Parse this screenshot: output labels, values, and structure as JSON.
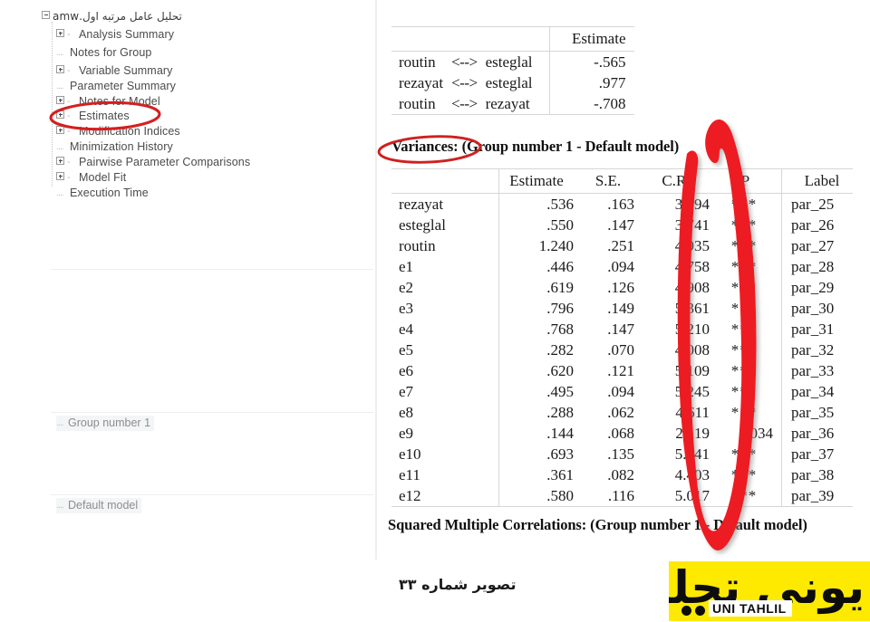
{
  "tree": {
    "root_label": "تحلیل عامل مرتبه اول.amw",
    "items": [
      {
        "label": "Analysis Summary",
        "expandable": true
      },
      {
        "label": "Notes for Group",
        "expandable": false
      },
      {
        "label": "Variable Summary",
        "expandable": true
      },
      {
        "label": "Parameter Summary",
        "expandable": false
      },
      {
        "label": "Notes for Model",
        "expandable": true
      },
      {
        "label": "Estimates",
        "expandable": true
      },
      {
        "label": "Modification Indices",
        "expandable": true
      },
      {
        "label": "Minimization History",
        "expandable": false
      },
      {
        "label": "Pairwise Parameter Comparisons",
        "expandable": true
      },
      {
        "label": "Model Fit",
        "expandable": true
      },
      {
        "label": "Execution Time",
        "expandable": false
      }
    ],
    "group_label": "Group number 1",
    "model_label": "Default model"
  },
  "output": {
    "correlations_table": {
      "header": [
        "",
        "",
        "",
        "Estimate"
      ],
      "rows": [
        {
          "from": "routin",
          "arrow": "<-->",
          "to": "esteglal",
          "estimate": "-.565"
        },
        {
          "from": "rezayat",
          "arrow": "<-->",
          "to": "esteglal",
          "estimate": ".977"
        },
        {
          "from": "routin",
          "arrow": "<-->",
          "to": "rezayat",
          "estimate": "-.708"
        }
      ]
    },
    "variances_heading": "Variances: (Group number 1 - Default model)",
    "variances_table": {
      "columns": [
        "",
        "Estimate",
        "S.E.",
        "C.R.",
        "P",
        "Label"
      ],
      "rows": [
        {
          "name": "rezayat",
          "estimate": ".536",
          "se": ".163",
          "cr": "3.294",
          "p": "***",
          "label": "par_25"
        },
        {
          "name": "esteglal",
          "estimate": ".550",
          "se": ".147",
          "cr": "3.741",
          "p": "***",
          "label": "par_26"
        },
        {
          "name": "routin",
          "estimate": "1.240",
          "se": ".251",
          "cr": "4.935",
          "p": "***",
          "label": "par_27"
        },
        {
          "name": "e1",
          "estimate": ".446",
          "se": ".094",
          "cr": "4.758",
          "p": "***",
          "label": "par_28"
        },
        {
          "name": "e2",
          "estimate": ".619",
          "se": ".126",
          "cr": "4.908",
          "p": "***",
          "label": "par_29"
        },
        {
          "name": "e3",
          "estimate": ".796",
          "se": ".149",
          "cr": "5.361",
          "p": "***",
          "label": "par_30"
        },
        {
          "name": "e4",
          "estimate": ".768",
          "se": ".147",
          "cr": "5.210",
          "p": "***",
          "label": "par_31"
        },
        {
          "name": "e5",
          "estimate": ".282",
          "se": ".070",
          "cr": "4.008",
          "p": "***",
          "label": "par_32"
        },
        {
          "name": "e6",
          "estimate": ".620",
          "se": ".121",
          "cr": "5.109",
          "p": "***",
          "label": "par_33"
        },
        {
          "name": "e7",
          "estimate": ".495",
          "se": ".094",
          "cr": "5.245",
          "p": "***",
          "label": "par_34"
        },
        {
          "name": "e8",
          "estimate": ".288",
          "se": ".062",
          "cr": "4.611",
          "p": "***",
          "label": "par_35"
        },
        {
          "name": "e9",
          "estimate": ".144",
          "se": ".068",
          "cr": "2.119",
          "p": ".034",
          "label": "par_36"
        },
        {
          "name": "e10",
          "estimate": ".693",
          "se": ".135",
          "cr": "5.141",
          "p": "***",
          "label": "par_37"
        },
        {
          "name": "e11",
          "estimate": ".361",
          "se": ".082",
          "cr": "4.403",
          "p": "***",
          "label": "par_38"
        },
        {
          "name": "e12",
          "estimate": ".580",
          "se": ".116",
          "cr": "5.017",
          "p": "***",
          "label": "par_39"
        }
      ]
    },
    "smc_heading": "Squared Multiple Correlations: (Group number 1 - Default model)"
  },
  "annotations": {
    "color": "#e01b1b",
    "ellipse_estimates_target": "Estimates",
    "ellipse_variances_target": "Variances:",
    "arrow_target_column": "P"
  },
  "footer": {
    "caption": "تصویر شماره ۳۳",
    "logo_script": "یونی تحلیل",
    "logo_latin": "UNI TAHLIL",
    "logo_background": "#fdea00"
  }
}
